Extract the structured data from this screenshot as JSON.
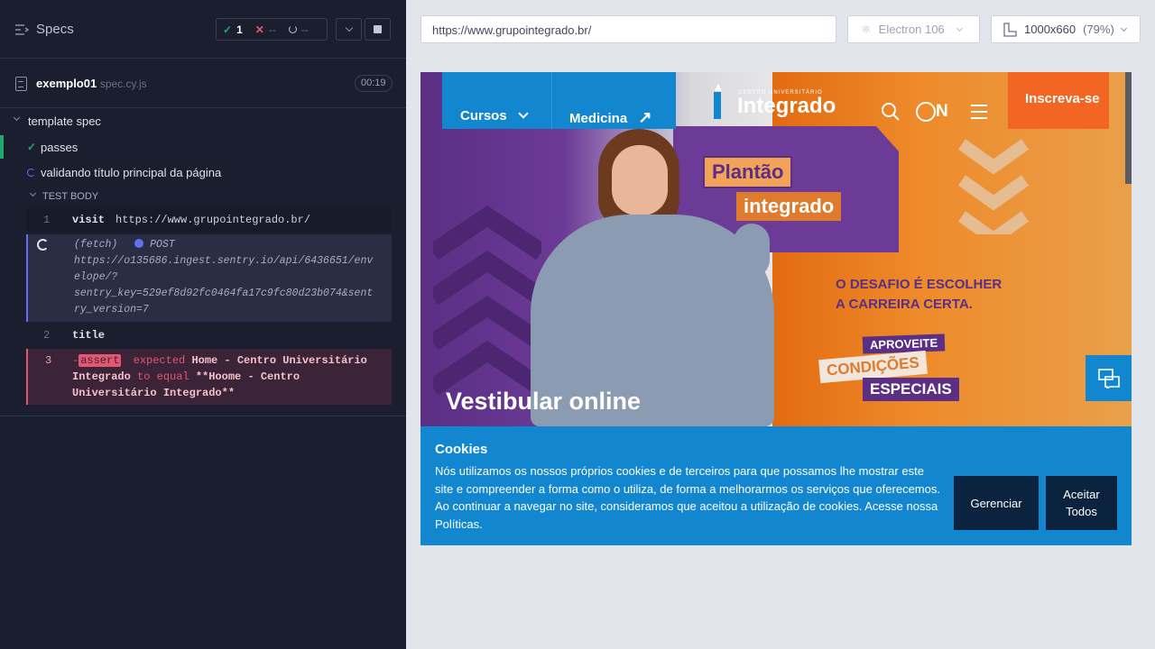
{
  "runner": {
    "header": {
      "title": "Specs",
      "passed": "1",
      "failed": "--",
      "pending": "--"
    },
    "spec": {
      "name": "exemplo01",
      "ext": "spec.cy.js",
      "duration": "00:19"
    },
    "suite": {
      "title": "template spec"
    },
    "tests": [
      {
        "title": "passes",
        "state": "passed"
      },
      {
        "title": "validando título principal da página",
        "state": "running"
      }
    ],
    "test_body_label": "TEST BODY",
    "commands": [
      {
        "num": "1",
        "name": "visit",
        "message": "https://www.grupointegrado.br/"
      },
      {
        "num": "",
        "name": "(fetch)",
        "method": "POST",
        "message_lines": [
          "https://o135686.ingest.sentry.io/api/6436651/env",
          "elope/?",
          "sentry_key=529ef8d92fc0464fa17c9fc80d23b074&sent",
          "ry_version=7"
        ]
      },
      {
        "num": "2",
        "name": "title",
        "message": ""
      },
      {
        "num": "3",
        "name": "-assert",
        "message_lines": [
          "expected",
          "Home - Centro Universitário",
          "Integrado",
          "to equal",
          "**Hoome - Centro",
          "Universitário Integrado**"
        ]
      }
    ]
  },
  "preview": {
    "url": "https://www.grupointegrado.br/",
    "browser": "Electron 106",
    "viewport": "1000x660",
    "zoom": "(79%)"
  },
  "site": {
    "nav": {
      "cursos": "Cursos",
      "medicina": "Medicina",
      "logo_small": "CENTRO UNIVERSITÁRIO",
      "logo": "Integrado",
      "on": "ON",
      "cta": "Inscreva-se"
    },
    "hero": {
      "badge1": "Plantão",
      "badge2": "integrado",
      "tagline1": "O DESAFIO É ESCOLHER",
      "tagline2": "A CARREIRA CERTA.",
      "promo1": "APROVEITE",
      "promo2": "CONDIÇÕES",
      "promo3": "ESPECIAIS",
      "title": "Vestibular online"
    },
    "cookie": {
      "title": "Cookies",
      "text": "Nós utilizamos os nossos próprios cookies e de terceiros para que possamos lhe mostrar este site e compreender a forma como o utiliza, de forma a melhorarmos os serviços que oferecemos. Ao continuar a navegar no site, consideramos que aceitou a utilização de cookies. Acesse nossa Políticas.",
      "manage": "Gerenciar",
      "accept": "Aceitar Todos"
    }
  },
  "colors": {
    "runner_bg": "#1b1e2e",
    "pass": "#1fa971",
    "fail": "#e45770",
    "running": "#6470f3",
    "site_blue": "#1287cf",
    "site_orange": "#f26522",
    "site_navy": "#0c2340"
  }
}
